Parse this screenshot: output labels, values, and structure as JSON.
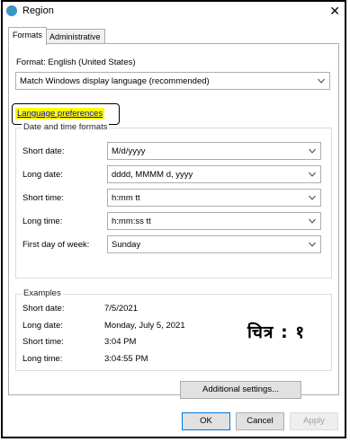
{
  "window": {
    "title": "Region",
    "close_glyph": "✕"
  },
  "tabs": [
    {
      "label": "Formats"
    },
    {
      "label": "Administrative"
    }
  ],
  "format": {
    "label": "Format: English (United States)",
    "value": "Match Windows display language (recommended)"
  },
  "language_link": "Language preferences",
  "date_time": {
    "group_title": "Date and time formats",
    "rows": [
      {
        "label": "Short date:",
        "value": "M/d/yyyy"
      },
      {
        "label": "Long date:",
        "value": "dddd, MMMM d, yyyy"
      },
      {
        "label": "Short time:",
        "value": "h:mm tt"
      },
      {
        "label": "Long time:",
        "value": "h:mm:ss tt"
      },
      {
        "label": "First day of week:",
        "value": "Sunday"
      }
    ]
  },
  "examples": {
    "group_title": "Examples",
    "rows": [
      {
        "label": "Short date:",
        "value": "7/5/2021"
      },
      {
        "label": "Long date:",
        "value": "Monday, July 5, 2021"
      },
      {
        "label": "Short time:",
        "value": "3:04 PM"
      },
      {
        "label": "Long time:",
        "value": "3:04:55 PM"
      }
    ]
  },
  "buttons": {
    "additional": "Additional settings...",
    "ok": "OK",
    "cancel": "Cancel",
    "apply": "Apply"
  },
  "annotation": "चित्र : १",
  "colors": {
    "link": "#0000cc",
    "highlight": "#ffff00",
    "ok_border": "#0078d7"
  },
  "icons": {
    "title": "globe-icon",
    "dropdown": "chevron-down-icon",
    "close": "close-icon"
  }
}
